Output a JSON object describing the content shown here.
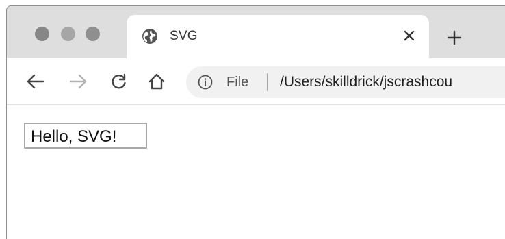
{
  "window": {
    "traffic_lights": [
      "close",
      "minimize",
      "maximize"
    ]
  },
  "tab": {
    "title": "SVG",
    "icon": "globe-icon",
    "close_icon": "close-icon"
  },
  "new_tab": {
    "icon": "plus-icon"
  },
  "toolbar": {
    "back_icon": "back-arrow-icon",
    "forward_icon": "forward-arrow-icon",
    "reload_icon": "reload-icon",
    "home_icon": "home-icon"
  },
  "address_bar": {
    "info_icon": "info-icon",
    "scheme": "File",
    "url": "/Users/skilldrick/jscrashcou"
  },
  "page": {
    "svg_text": "Hello, SVG!"
  }
}
